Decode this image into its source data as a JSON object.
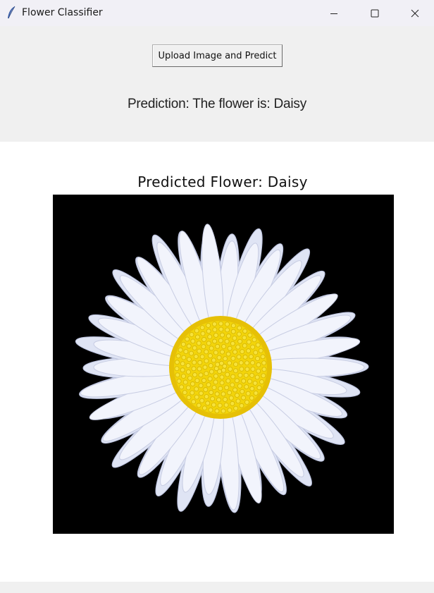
{
  "window": {
    "title": "Flower Classifier",
    "icon": "feather-icon"
  },
  "controls": {
    "upload_button_label": "Upload Image and Predict"
  },
  "result": {
    "prediction_text": "Prediction: The flower is: Daisy"
  },
  "figure": {
    "title": "Predicted Flower: Daisy",
    "image_subject": "daisy-photo",
    "colors": {
      "background": "#000000",
      "petals": "#eef1fb",
      "center": "#f2d40a"
    }
  }
}
